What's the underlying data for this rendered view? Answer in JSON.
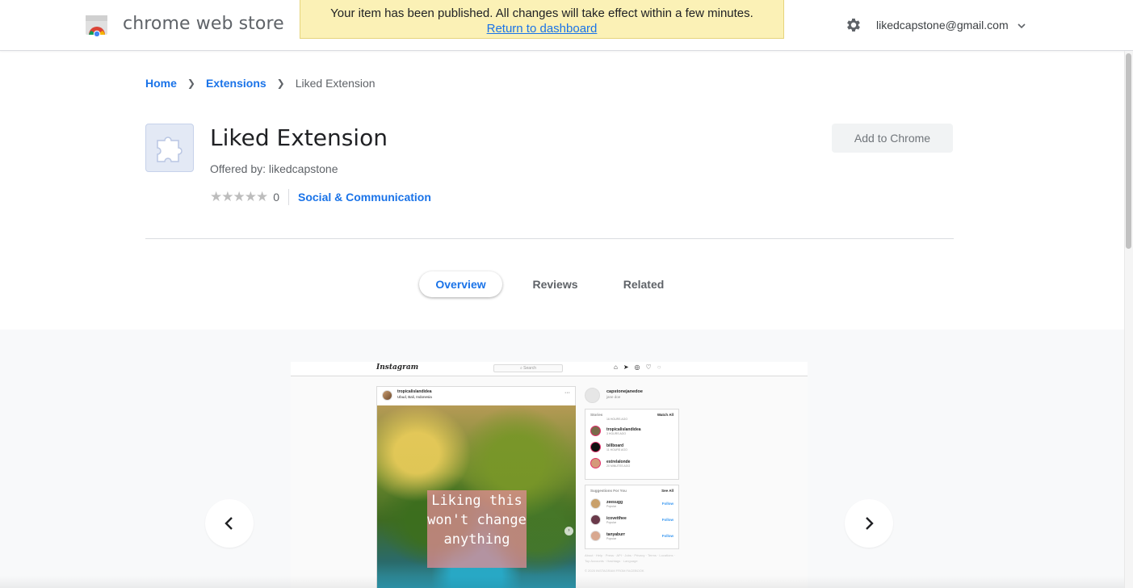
{
  "header": {
    "store_title": "chrome web store",
    "toast_message": "Your item has been published. All changes will take effect within a few minutes.",
    "toast_link": "Return to dashboard",
    "account_email": "likedcapstone@gmail.com"
  },
  "breadcrumb": {
    "home": "Home",
    "extensions": "Extensions",
    "current": "Liked Extension"
  },
  "item": {
    "name": "Liked Extension",
    "offered_by": "Offered by: likedcapstone",
    "rating_count": "0",
    "stars": "★★★★★",
    "category": "Social & Communication",
    "add_button": "Add to Chrome"
  },
  "tabs": [
    {
      "label": "Overview",
      "active": true
    },
    {
      "label": "Reviews",
      "active": false
    },
    {
      "label": "Related",
      "active": false
    }
  ],
  "screenshot": {
    "app_logo": "Instagram",
    "search_placeholder": "Search",
    "post_user": "tropicalislandidea",
    "post_location": "Ubud, Bali, Indonesia",
    "overlay_text": "Liking this won't change anything",
    "me_user": "capstonejanedoe",
    "me_name": "jane doe",
    "stories_title": "Stories",
    "stories_action": "Watch All",
    "stories": [
      {
        "name": "",
        "time": "16 HOURS AGO"
      },
      {
        "name": "tropicalislandidea",
        "time": "3 HOURS AGO"
      },
      {
        "name": "billboard",
        "time": "11 HOURS AGO"
      },
      {
        "name": "estrelalonde",
        "time": "20 MINUTES AGO"
      }
    ],
    "suggestions_title": "Suggestions For You",
    "suggestions_action": "See All",
    "suggestions": [
      {
        "name": "zeesugg",
        "sub": "Popular",
        "action": "Follow"
      },
      {
        "name": "icovetthee",
        "sub": "Popular",
        "action": "Follow"
      },
      {
        "name": "tanyaburr",
        "sub": "Popular",
        "action": "Follow"
      }
    ],
    "footer_links": "About · Help · Press · API · Jobs · Privacy · Terms · Locations · Top Accounts · Hashtags · Language",
    "footer_copy": "© 2020 INSTAGRAM FROM FACEBOOK"
  },
  "colors": {
    "link_blue": "#1a73e8",
    "toast_bg": "#fbf1b6",
    "carousel_bg": "#f8f9fa"
  },
  "icons": [
    "chrome-web-store-logo",
    "gear-icon",
    "chevron-down-icon",
    "chevron-right-icon",
    "puzzle-icon",
    "star-icon",
    "chevron-left-icon"
  ]
}
